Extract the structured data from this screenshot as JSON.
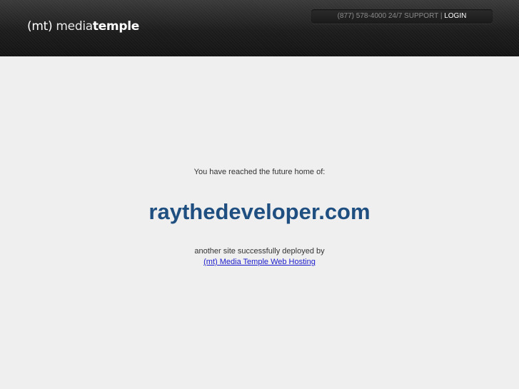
{
  "header": {
    "logo": {
      "mt": "(mt)",
      "media": "media",
      "temple": "temple"
    },
    "phone_support": "(877) 578-4000 24/7 SUPPORT",
    "separator": "|",
    "login_label": "LOGIN"
  },
  "main": {
    "intro": "You have reached the future home of:",
    "domain": "raythedeveloper.com",
    "deployed_text": "another site successfully deployed by",
    "host_link": "(mt) Media Temple Web Hosting"
  },
  "colors": {
    "header_bg": "#1c1c1c",
    "page_bg": "#efefef",
    "domain": "#1f4f80",
    "link": "#1a1acc"
  }
}
